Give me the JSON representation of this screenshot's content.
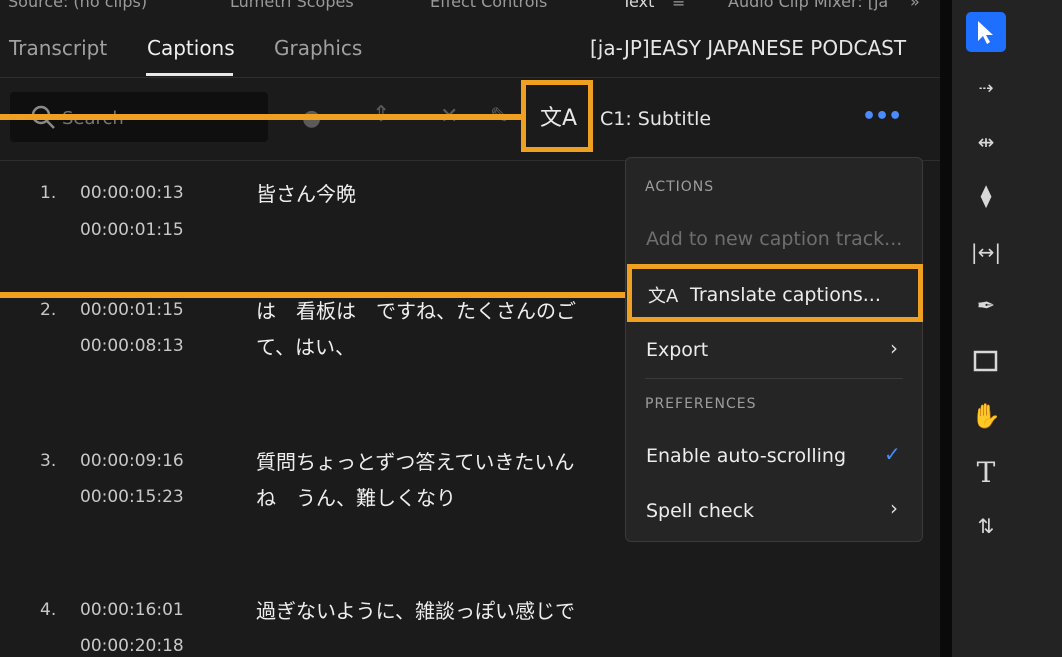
{
  "panel_tabs": [
    "Source: (no clips)",
    "Lumetri Scopes",
    "Effect Controls",
    "Text",
    "Audio Clip Mixer: [ja",
    "»"
  ],
  "sub_tabs": {
    "transcript": "Transcript",
    "captions": "Captions",
    "graphics": "Graphics"
  },
  "sequence_name": "[ja-JP]EASY JAPANESE PODCAST",
  "search": {
    "placeholder": "Search"
  },
  "track_label": "C1: Subtitle",
  "captions": [
    {
      "num": "1.",
      "start": "00:00:00:13",
      "end": "00:00:01:15",
      "text1": "皆さん今晩",
      "text2": ""
    },
    {
      "num": "2.",
      "start": "00:00:01:15",
      "end": "00:00:08:13",
      "text1": "は　看板は　ですね、たくさんのご",
      "text2": "て、はい、"
    },
    {
      "num": "3.",
      "start": "00:00:09:16",
      "end": "00:00:15:23",
      "text1": "質問ちょっとずつ答えていきたいん",
      "text2": "ね　うん、難しくなり"
    },
    {
      "num": "4.",
      "start": "00:00:16:01",
      "end": "00:00:20:18",
      "text1": "過ぎないように、雑談っぽい感じで",
      "text2": ""
    }
  ],
  "menu": {
    "actions_header": "ACTIONS",
    "add_track": "Add to new caption track...",
    "translate": "Translate captions...",
    "export": "Export",
    "preferences_header": "PREFERENCES",
    "auto_scroll": "Enable auto-scrolling",
    "spell_check": "Spell check"
  },
  "colors": {
    "accent": "#4a8cff",
    "annotation": "#f0a020",
    "tool_selected": "#1f6fff"
  }
}
